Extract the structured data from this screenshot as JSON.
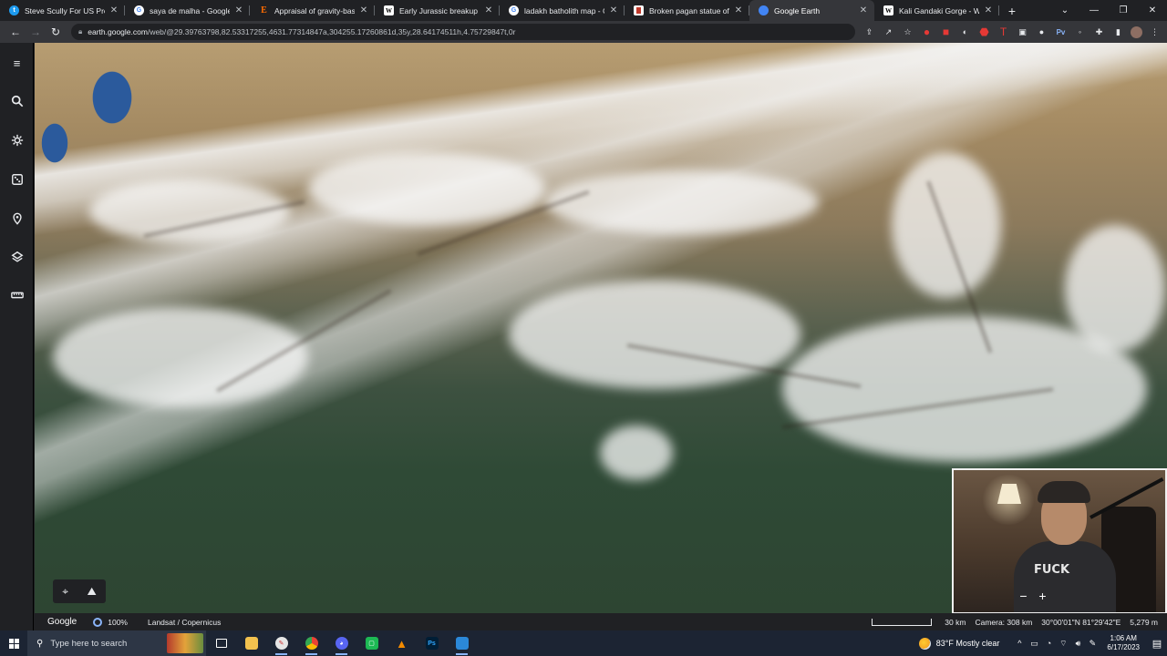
{
  "tabs": [
    {
      "title": "Steve Scully For US Preside",
      "favicon": "twitter-icon",
      "active": false
    },
    {
      "title": "saya de malha - Google Se",
      "favicon": "google-icon",
      "active": false
    },
    {
      "title": "Appraisal of gravity-based",
      "favicon": "e-icon",
      "active": false
    },
    {
      "title": "Early Jurassic breakup of G",
      "favicon": "wikipedia-icon",
      "active": false
    },
    {
      "title": "ladakh batholith map - Go",
      "favicon": "google-icon",
      "active": false
    },
    {
      "title": "Broken pagan statue of Gr",
      "favicon": "bookmark-icon",
      "active": false
    },
    {
      "title": "Google Earth",
      "favicon": "google-earth-icon",
      "active": true
    },
    {
      "title": "Kali Gandaki Gorge - Wikip",
      "favicon": "wikipedia-icon",
      "active": false
    }
  ],
  "url": {
    "host": "earth.google.com",
    "path": "/web/@29.39763798,82.53317255,4631.77314847a,304255.17260861d,35y,28.64174511h,4.75729847t,0r"
  },
  "map_status": {
    "brand": "Google",
    "zoom_percent": "100%",
    "credits": "Landsat / Copernicus",
    "scale_label": "30 km",
    "camera": "Camera: 308 km",
    "coordinates": "30°00'01\"N 81°29'42\"E",
    "elevation": "5,279 m"
  },
  "map_controls": {
    "zoom_out": "−",
    "zoom_in": "+"
  },
  "taskbar": {
    "search_placeholder": "Type here to search",
    "weather": "83°F  Mostly clear",
    "time": "1:06 AM",
    "date": "6/17/2023"
  },
  "webcam": {
    "shirt_text": "FUCK"
  },
  "colors": {
    "chrome_dark": "#202124",
    "chrome_toolbar": "#35363a",
    "taskbar": "#1c2433",
    "accent": "#8ab4f8"
  }
}
